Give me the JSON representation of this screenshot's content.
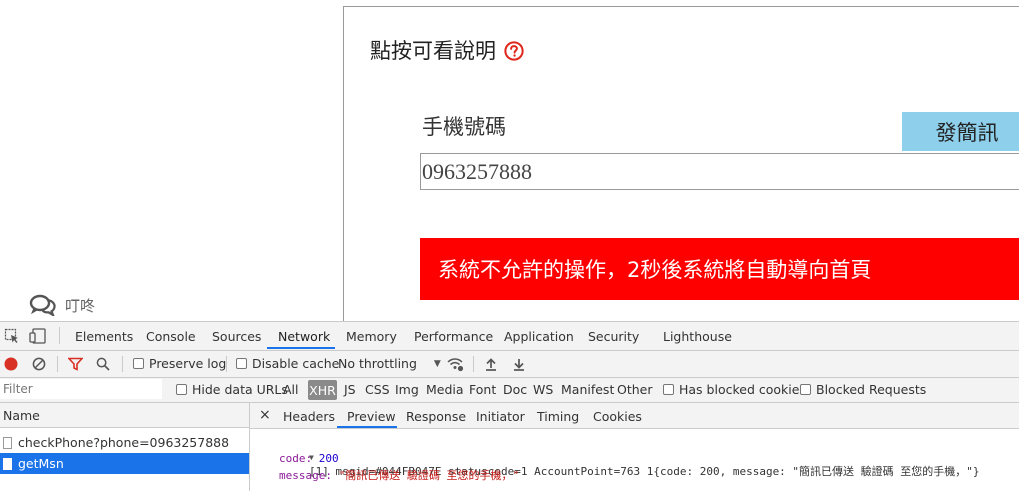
{
  "page": {
    "help_text": "點按可看說明",
    "phone_label": "手機號碼",
    "send_sms_button": "發簡訊",
    "phone_value": "0963257888",
    "alert_message": "系統不允許的操作，2秒後系統將自動導向首頁",
    "chat_label": "叮咚",
    "colors": {
      "alert": "#fe0000",
      "button": "#8ed0ec",
      "help_icon": "#e0251b"
    }
  },
  "devtools": {
    "tabs": [
      "Elements",
      "Console",
      "Sources",
      "Network",
      "Memory",
      "Performance",
      "Application",
      "Security",
      "Lighthouse"
    ],
    "active_tab": "Network",
    "toolbar": {
      "preserve_log": "Preserve log",
      "disable_cache": "Disable cache",
      "throttling": "No throttling"
    },
    "filter": {
      "placeholder": "Filter",
      "hide_data_urls": "Hide data URLs",
      "types": [
        "All",
        "XHR",
        "JS",
        "CSS",
        "Img",
        "Media",
        "Font",
        "Doc",
        "WS",
        "Manifest",
        "Other"
      ],
      "active_type": "XHR",
      "has_blocked_cookies": "Has blocked cookies",
      "blocked_requests": "Blocked Requests"
    },
    "list": {
      "header": "Name",
      "rows": [
        "checkPhone?phone=0963257888",
        "getMsn"
      ],
      "selected": "getMsn"
    },
    "detail": {
      "close": "×",
      "tabs": [
        "Headers",
        "Preview",
        "Response",
        "Initiator",
        "Timing",
        "Cookies"
      ],
      "active_tab": "Preview",
      "preview": {
        "summary": "[1] msgid=#044FB047E statuscode=1 AccountPoint=763 1{code: 200, message: \"簡訊已傳送 驗證碼 至您的手機，\"}",
        "code_key": "code",
        "code_value": "200",
        "message_key": "message",
        "message_value": "\"簡訊已傳送 驗證碼 至您的手機，\""
      }
    }
  }
}
